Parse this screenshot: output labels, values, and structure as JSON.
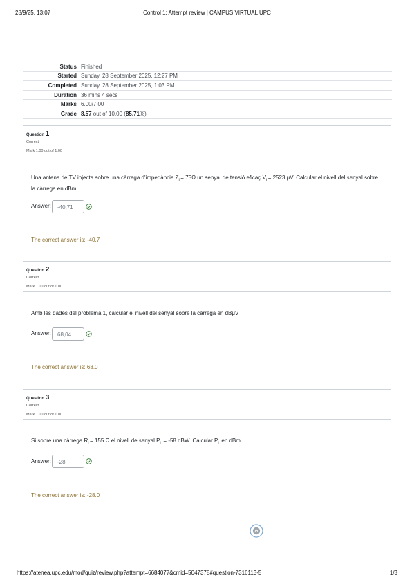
{
  "print_header": {
    "datetime": "28/9/25, 13:07",
    "title": "Control 1: Attempt review | CAMPUS VIRTUAL UPC"
  },
  "summary": {
    "rows": [
      {
        "label": "Status",
        "value": "Finished"
      },
      {
        "label": "Started",
        "value": "Sunday, 28 September 2025, 12:27 PM"
      },
      {
        "label": "Completed",
        "value": "Sunday, 28 September 2025, 1:03 PM"
      },
      {
        "label": "Duration",
        "value": "36 mins 4 secs"
      },
      {
        "label": "Marks",
        "value": "6.00/7.00"
      }
    ],
    "grade": {
      "label": "Grade",
      "score": "8.57",
      "middle": " out of 10.00 (",
      "percent": "85.71",
      "end": "%)"
    }
  },
  "questions": [
    {
      "prefix": "Question",
      "number": "1",
      "state": "Correct",
      "grade": "Mark 1.00 out of 1.00",
      "text_parts": [
        "Una antena de TV injecta sobre una càrrega d'impedància Z",
        "L",
        "= 75Ω un senyal de tensió eficaç V",
        "L",
        "= 2523 μV. Calcular el nivell del senyal sobre la càrrega en dBm"
      ],
      "answer_label": "Answer:",
      "answer_value": "-40,71",
      "right_answer": "The correct answer is: -40.7"
    },
    {
      "prefix": "Question",
      "number": "2",
      "state": "Correct",
      "grade": "Mark 1.00 out of 1.00",
      "text": "Amb les dades del problema 1, calcular el nivell del senyal sobre la càrrega en dBμV",
      "answer_label": "Answer:",
      "answer_value": "68,04",
      "right_answer": "The correct answer is: 68.0"
    },
    {
      "prefix": "Question",
      "number": "3",
      "state": "Correct",
      "grade": "Mark 1.00 out of 1.00",
      "text_parts": [
        "Si sobre una càrrega R",
        "L",
        "= 155 Ω el nivell de senyal  P",
        "L",
        " = -58 dBW. Calcular  P",
        "L",
        " en dBm."
      ],
      "answer_label": "Answer:",
      "answer_value": "-28",
      "right_answer": "The correct answer is: -28.0"
    }
  ],
  "colors": {
    "correct_icon": "#357a32",
    "right_answer_text": "#8f7231",
    "nav_circle": "#0f6cbf"
  },
  "icons": {
    "correct": "check-circle-icon",
    "navigation": "page-nav-circle-icon"
  },
  "print_footer": {
    "url": "https://atenea.upc.edu/mod/quiz/review.php?attempt=6684077&cmid=5047378#question-7316113-5",
    "page": "1/3"
  }
}
